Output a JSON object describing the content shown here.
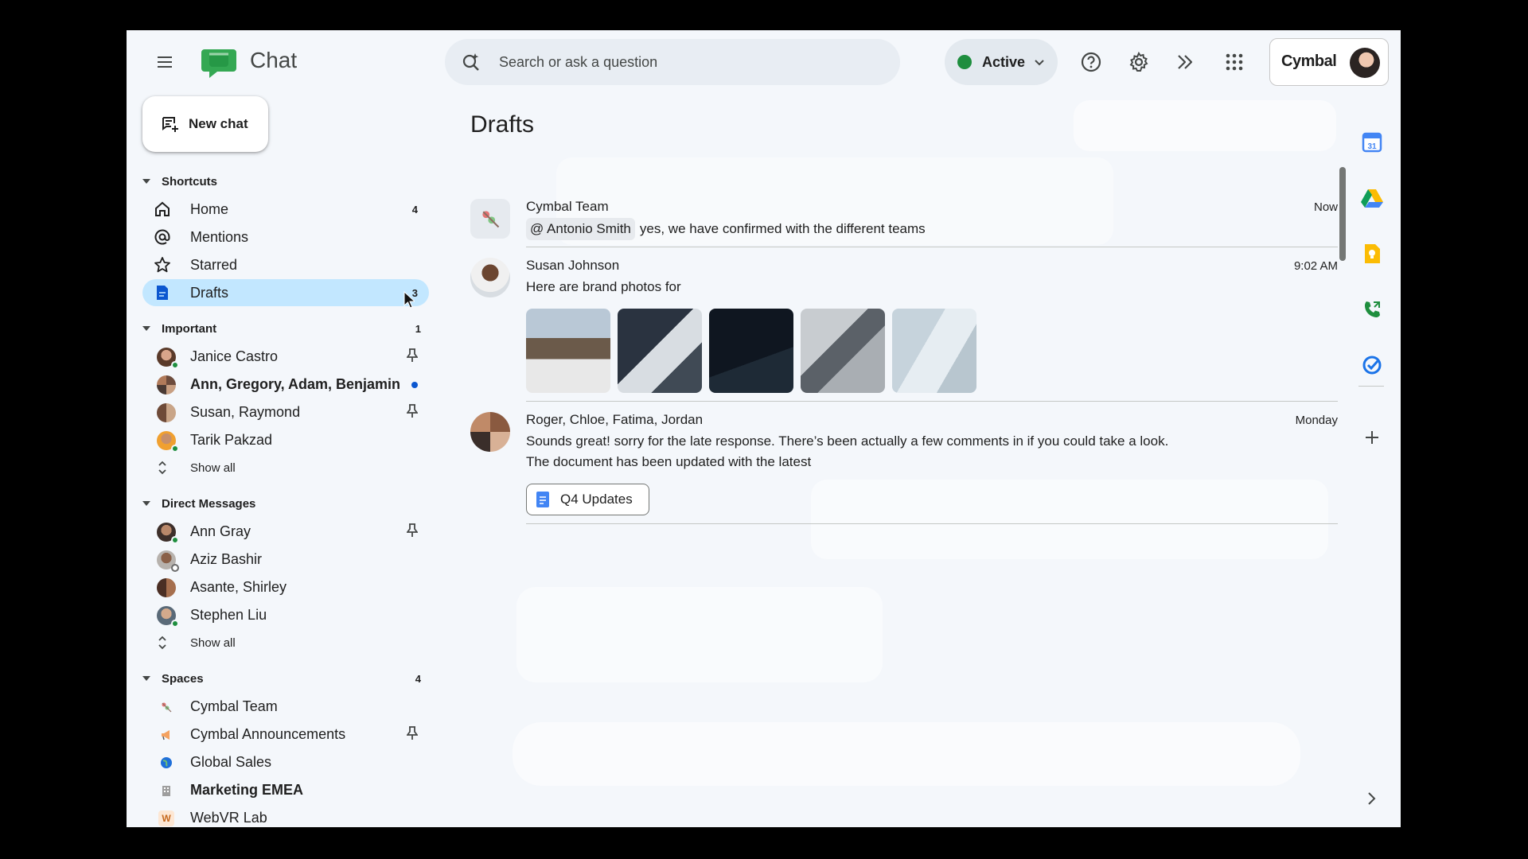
{
  "app": {
    "title": "Chat"
  },
  "search": {
    "placeholder": "Search or ask a question"
  },
  "status": {
    "label": "Active",
    "color": "#1e8e3e"
  },
  "account": {
    "brand": "Cymbal"
  },
  "new_chat": {
    "label": "New chat"
  },
  "sections": {
    "shortcuts": {
      "label": "Shortcuts"
    },
    "important": {
      "label": "Important",
      "count": "1"
    },
    "direct_messages": {
      "label": "Direct Messages"
    },
    "spaces": {
      "label": "Spaces",
      "count": "4"
    }
  },
  "shortcuts": [
    {
      "label": "Home",
      "count": "4",
      "icon": "home-icon"
    },
    {
      "label": "Mentions",
      "count": "",
      "icon": "at-icon"
    },
    {
      "label": "Starred",
      "count": "",
      "icon": "star-icon"
    },
    {
      "label": "Drafts",
      "count": "3",
      "icon": "draft-icon"
    }
  ],
  "important": [
    {
      "label": "Janice Castro",
      "pinned": true
    },
    {
      "label": "Ann, Gregory, Adam, Benjamin",
      "unread": true
    },
    {
      "label": "Susan, Raymond",
      "pinned": true
    },
    {
      "label": "Tarik Pakzad"
    },
    {
      "label": "Show all"
    }
  ],
  "direct_messages": [
    {
      "label": "Ann Gray",
      "pinned": true
    },
    {
      "label": "Aziz Bashir"
    },
    {
      "label": "Asante, Shirley"
    },
    {
      "label": "Stephen Liu"
    },
    {
      "label": "Show all"
    }
  ],
  "spaces": [
    {
      "label": "Cymbal Team"
    },
    {
      "label": "Cymbal Announcements",
      "pinned": true
    },
    {
      "label": "Global Sales"
    },
    {
      "label": "Marketing EMEA",
      "bold": true
    },
    {
      "label": "WebVR Lab",
      "icon_letter": "W"
    }
  ],
  "main": {
    "title": "Drafts",
    "messages": [
      {
        "sender": "Cymbal Team",
        "time": "Now",
        "mention": "@ Antonio Smith",
        "text": "yes, we have confirmed with the different teams"
      },
      {
        "sender": "Susan Johnson",
        "time": "9:02 AM",
        "text": "Here are brand photos for",
        "photos": 5
      },
      {
        "sender": "Roger, Chloe, Fatima, Jordan",
        "time": "Monday",
        "text_line1": "Sounds great! sorry for the late response. There’s been actually a few comments in if you could take a look.",
        "text_line2": "The document has been updated with the latest",
        "attachment": "Q4 Updates"
      }
    ]
  }
}
